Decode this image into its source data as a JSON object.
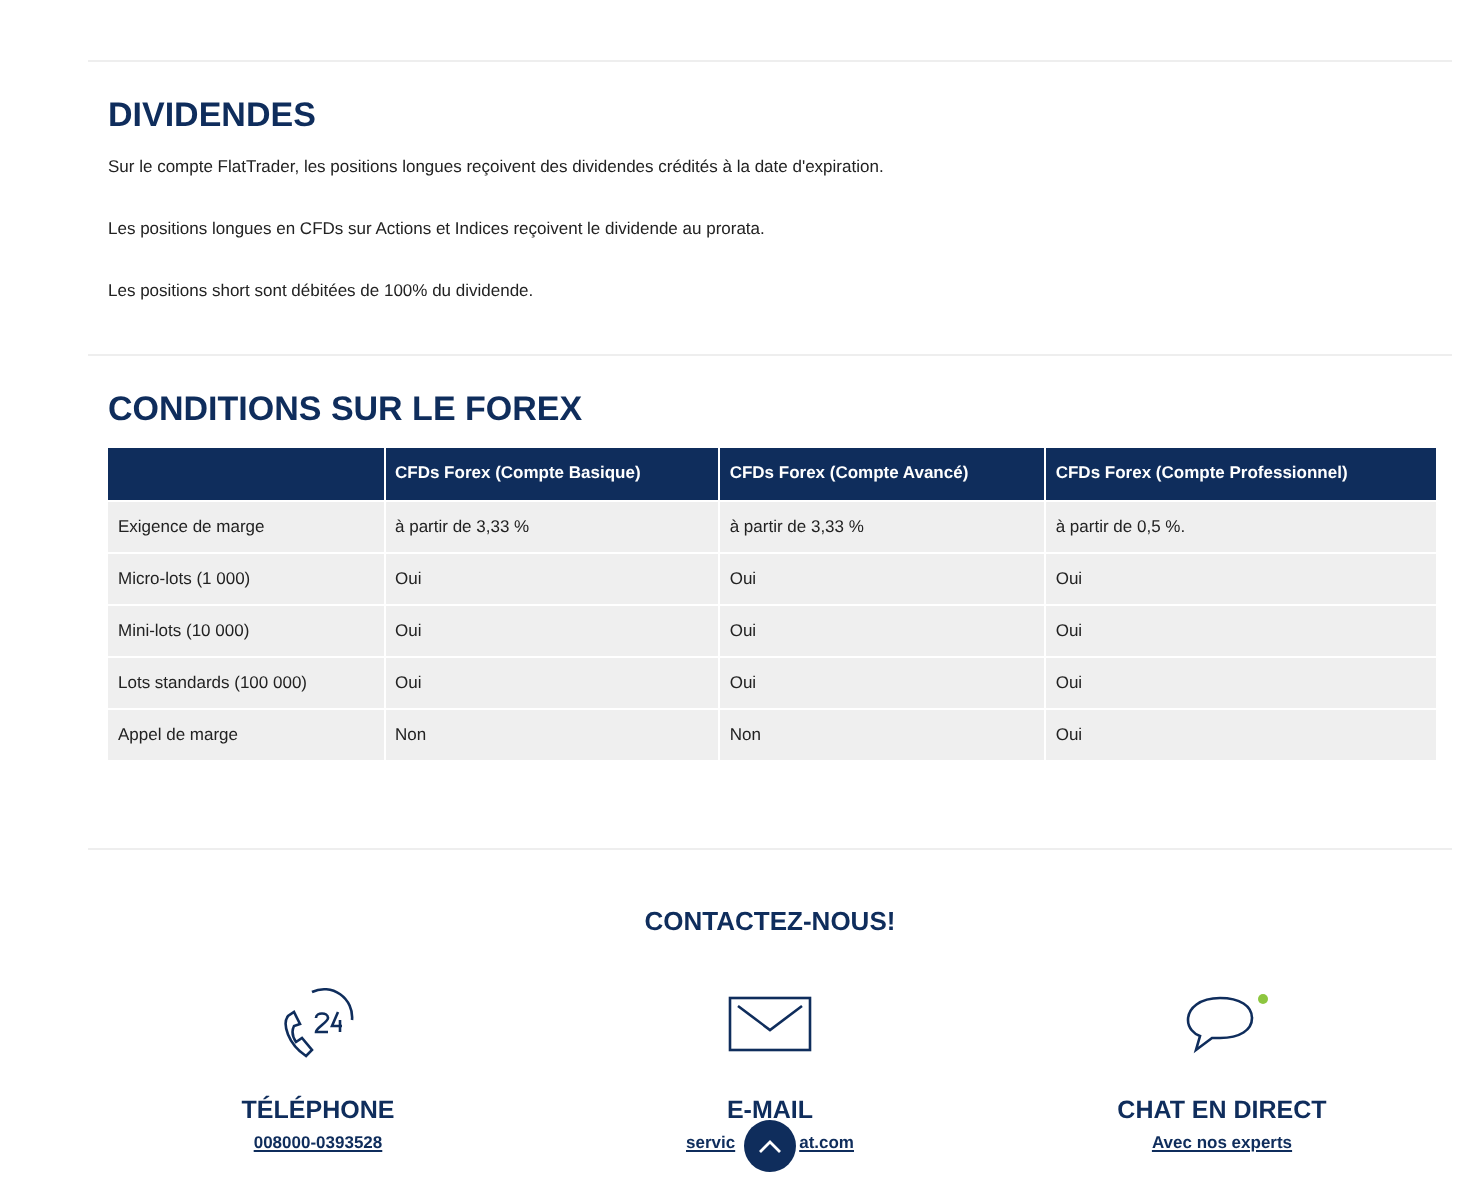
{
  "dividends": {
    "title": "DIVIDENDES",
    "paragraphs": [
      "Sur le compte FlatTrader, les positions longues reçoivent des dividendes crédités à la date d'expiration.",
      "Les positions longues en CFDs sur Actions et Indices reçoivent le dividende au prorata.",
      "Les positions short sont débitées de 100% du dividende."
    ]
  },
  "forex": {
    "title": "CONDITIONS SUR LE FOREX",
    "table": {
      "columns": [
        "CFDs Forex (Compte Basique)",
        "CFDs Forex (Compte Avancé)",
        "CFDs Forex (Compte Professionnel)"
      ],
      "rows": [
        {
          "label": "Exigence de marge",
          "cells": [
            "à partir de 3,33 %",
            "à partir de 3,33 %",
            "à partir de 0,5 %."
          ]
        },
        {
          "label": "Micro-lots (1 000)",
          "cells": [
            "Oui",
            "Oui",
            "Oui"
          ]
        },
        {
          "label": "Mini-lots (10 000)",
          "cells": [
            "Oui",
            "Oui",
            "Oui"
          ]
        },
        {
          "label": "Lots standards (100 000)",
          "cells": [
            "Oui",
            "Oui",
            "Oui"
          ]
        },
        {
          "label": "Appel de marge",
          "cells": [
            "Non",
            "Non",
            "Oui"
          ]
        }
      ]
    }
  },
  "contact": {
    "title": "CONTACTEZ-NOUS!",
    "items": [
      {
        "kind": "phone",
        "title": "TÉLÉPHONE",
        "link": [
          "008000-0393528"
        ]
      },
      {
        "kind": "email",
        "title": "E-MAIL",
        "link": [
          "servic",
          "at.com"
        ]
      },
      {
        "kind": "chat",
        "title": "CHAT EN DIRECT",
        "link": [
          "Avec nos experts"
        ],
        "online": true
      }
    ]
  }
}
